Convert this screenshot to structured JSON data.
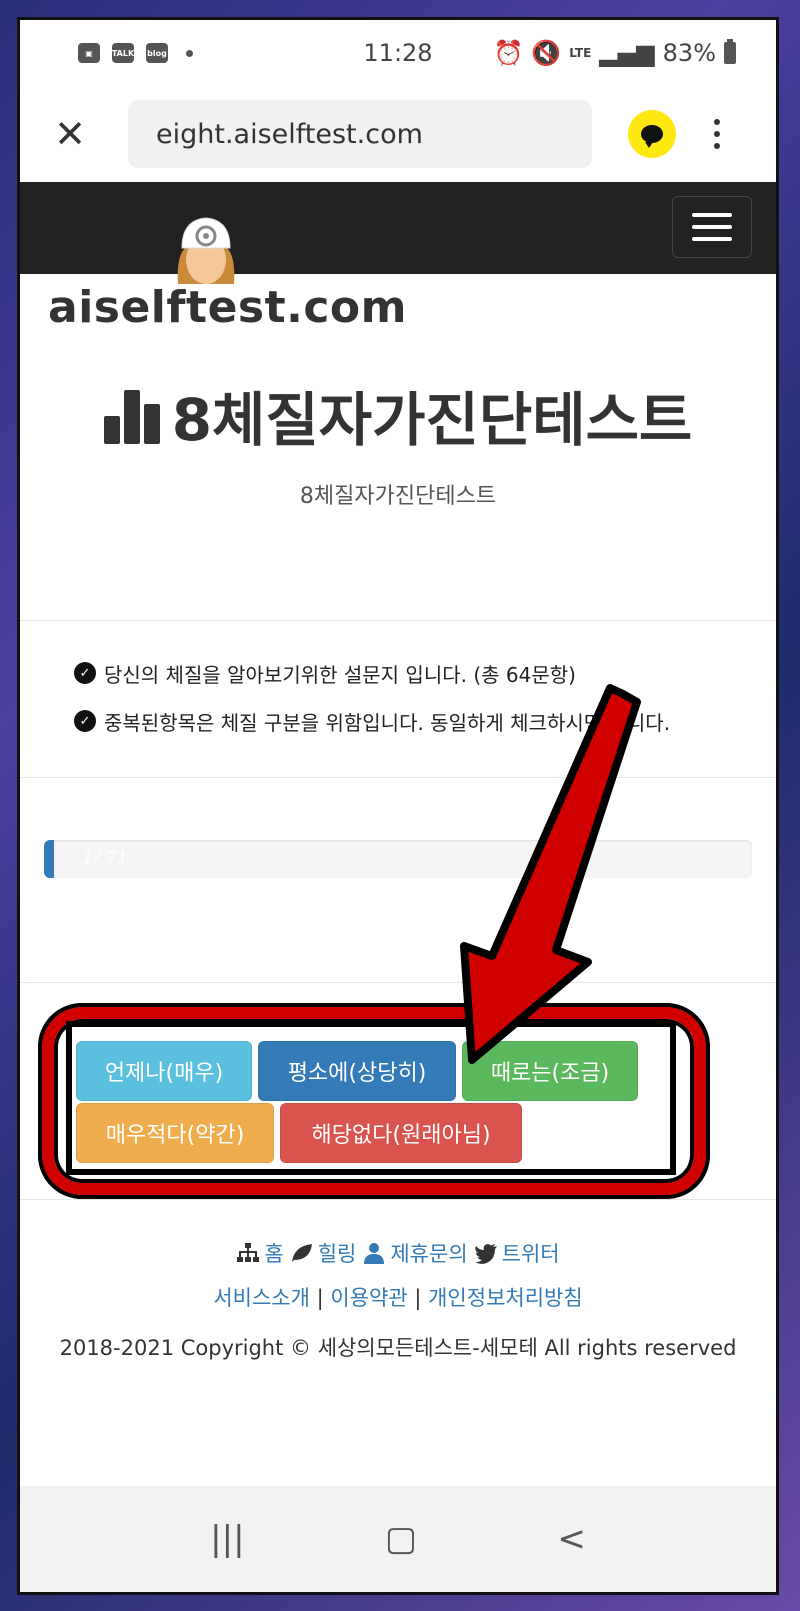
{
  "status_bar": {
    "time": "11:28",
    "left_icons": [
      "image-icon",
      "talk-icon",
      "blog-icon"
    ],
    "talk_label": "TALK",
    "blog_label": "blog",
    "network": "LTE",
    "battery": "83%"
  },
  "browser": {
    "url": "eight.aiselftest.com"
  },
  "site": {
    "logo_text": "aiselftest.com"
  },
  "page": {
    "title": "8체질자가진단테스트",
    "subtitle": "8체질자가진단테스트"
  },
  "info": {
    "items": [
      "당신의 체질을 알아보기위한 설문지 입니다. (총 64문항)",
      "중복된항목은 체질 구분을 위함입니다. 동일하게 체크하시면 됩니다."
    ]
  },
  "progress": {
    "text": "1/ 71",
    "current": 1,
    "total": 71
  },
  "answers": {
    "always": "언제나(매우)",
    "usually": "평소에(상당히)",
    "sometimes": "때로는(조금)",
    "rarely": "매우적다(약간)",
    "never": "해당없다(원래아님)"
  },
  "footer": {
    "home": "홈",
    "healing": "힐링",
    "partnership": "제휴문의",
    "twitter": "트위터",
    "service": "서비스소개",
    "terms": "이용약관",
    "privacy": "개인정보처리방침",
    "separator": "|",
    "copyright": "2018-2021 Copyright © 세상의모든테스트-세모테 All rights reserved"
  },
  "colors": {
    "info_btn": "#5bc0de",
    "primary_btn": "#337ab7",
    "success_btn": "#5cb85c",
    "warning_btn": "#f0ad4e",
    "danger_btn": "#d9534f",
    "annotation": "#e00000"
  }
}
